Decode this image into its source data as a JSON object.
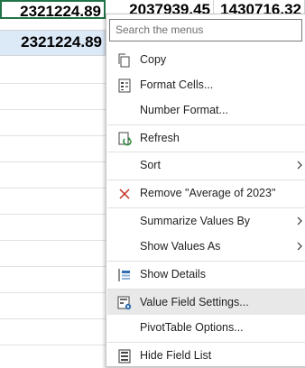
{
  "sheet": {
    "row1": [
      "2321224.89",
      "2037939.45",
      "1430716.32"
    ],
    "row2": [
      "2321224.89",
      "",
      ""
    ]
  },
  "menu": {
    "search_placeholder": "Search the menus",
    "items": [
      {
        "label": "Copy",
        "icon": "copy-icon"
      },
      {
        "label": "Format Cells...",
        "icon": "format-cells-icon"
      },
      {
        "label": "Number Format..."
      },
      {
        "label": "Refresh",
        "icon": "refresh-icon"
      },
      {
        "label": "Sort",
        "submenu": true
      },
      {
        "label": "Remove \"Average of 2023\"",
        "icon": "remove-icon"
      },
      {
        "label": "Summarize Values By",
        "submenu": true
      },
      {
        "label": "Show Values As",
        "submenu": true
      },
      {
        "label": "Show Details",
        "icon": "show-details-icon"
      },
      {
        "label": "Value Field Settings...",
        "icon": "field-settings-icon"
      },
      {
        "label": "PivotTable Options..."
      },
      {
        "label": "Hide Field List",
        "icon": "field-list-icon"
      }
    ]
  },
  "colors": {
    "accent_green": "#217346",
    "selection_blue": "#dce9f7",
    "remove_red": "#c42b1c",
    "icon_blue": "#2f6fb0"
  }
}
